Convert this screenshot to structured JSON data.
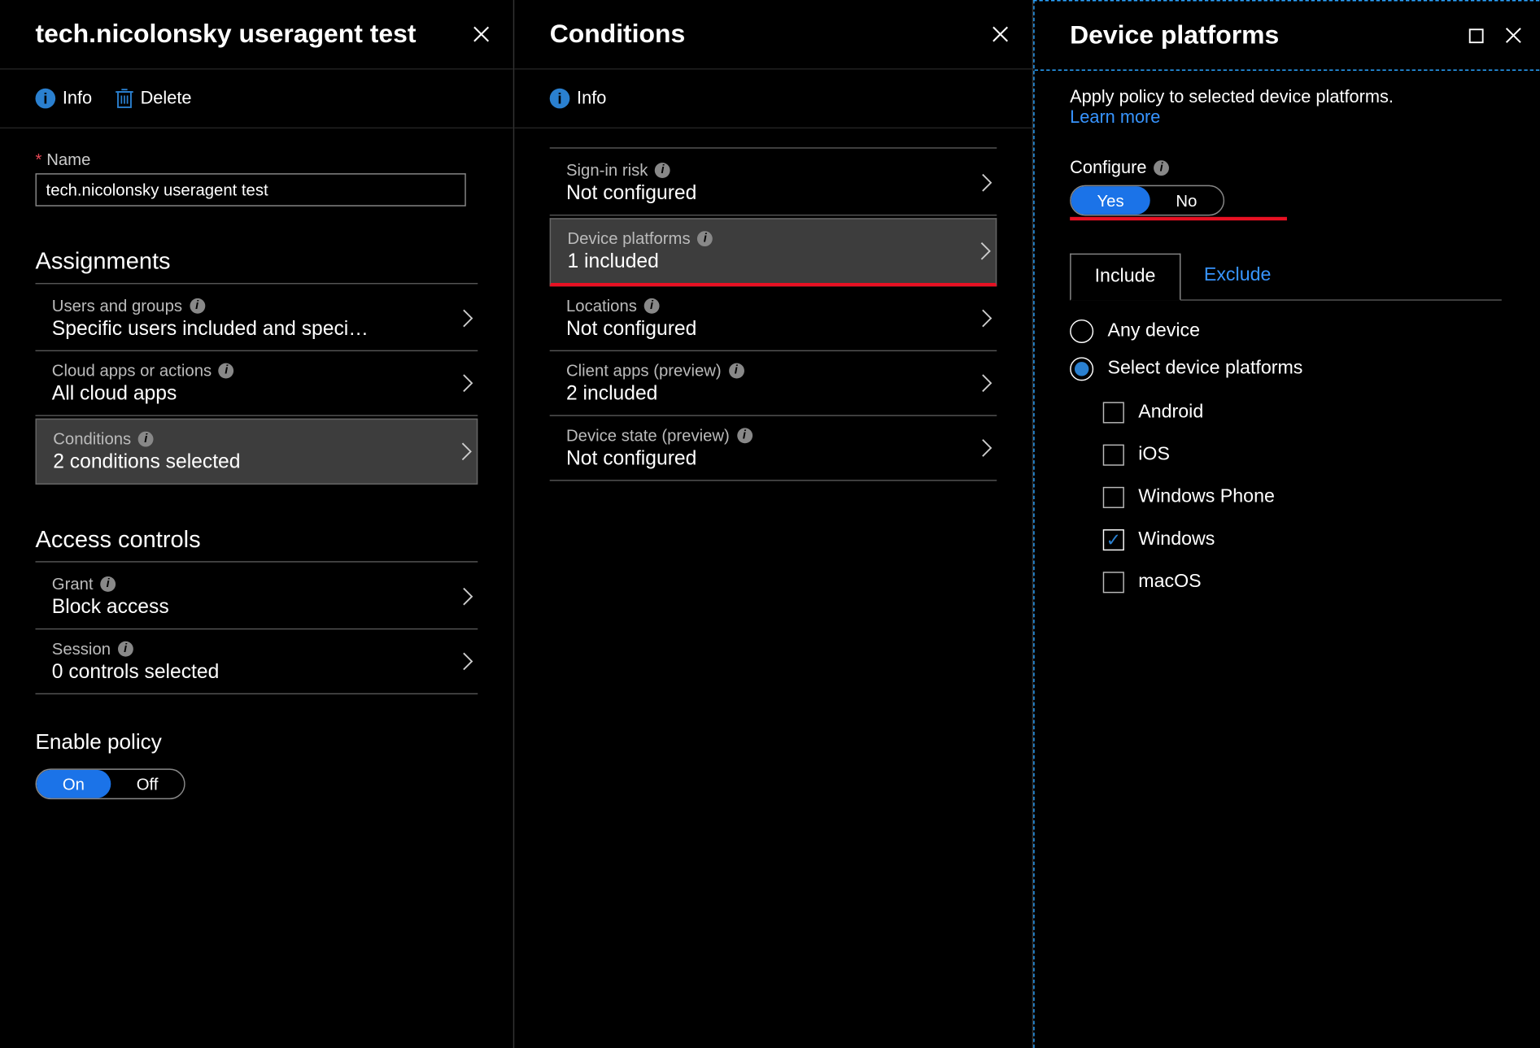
{
  "panel1": {
    "title": "tech.nicolonsky useragent test",
    "toolbar": {
      "info": "Info",
      "delete": "Delete"
    },
    "name_label": "Name",
    "name_value": "tech.nicolonsky useragent test",
    "assignments_title": "Assignments",
    "assignments": [
      {
        "label": "Users and groups",
        "value": "Specific users included and speci…"
      },
      {
        "label": "Cloud apps or actions",
        "value": "All cloud apps"
      },
      {
        "label": "Conditions",
        "value": "2 conditions selected"
      }
    ],
    "access_title": "Access controls",
    "access": [
      {
        "label": "Grant",
        "value": "Block access"
      },
      {
        "label": "Session",
        "value": "0 controls selected"
      }
    ],
    "enable_title": "Enable policy",
    "enable_on": "On",
    "enable_off": "Off"
  },
  "panel2": {
    "title": "Conditions",
    "toolbar": {
      "info": "Info"
    },
    "conditions": [
      {
        "label": "Sign-in risk",
        "value": "Not configured"
      },
      {
        "label": "Device platforms",
        "value": "1 included"
      },
      {
        "label": "Locations",
        "value": "Not configured"
      },
      {
        "label": "Client apps (preview)",
        "value": "2 included"
      },
      {
        "label": "Device state (preview)",
        "value": "Not configured"
      }
    ]
  },
  "panel3": {
    "title": "Device platforms",
    "description": "Apply policy to selected device platforms.",
    "learn_more": "Learn more",
    "configure_label": "Configure",
    "yes": "Yes",
    "no": "No",
    "tabs": {
      "include": "Include",
      "exclude": "Exclude"
    },
    "radio_any": "Any device",
    "radio_select": "Select device platforms",
    "platforms": [
      {
        "name": "Android",
        "checked": false
      },
      {
        "name": "iOS",
        "checked": false
      },
      {
        "name": "Windows Phone",
        "checked": false
      },
      {
        "name": "Windows",
        "checked": true
      },
      {
        "name": "macOS",
        "checked": false
      }
    ]
  }
}
